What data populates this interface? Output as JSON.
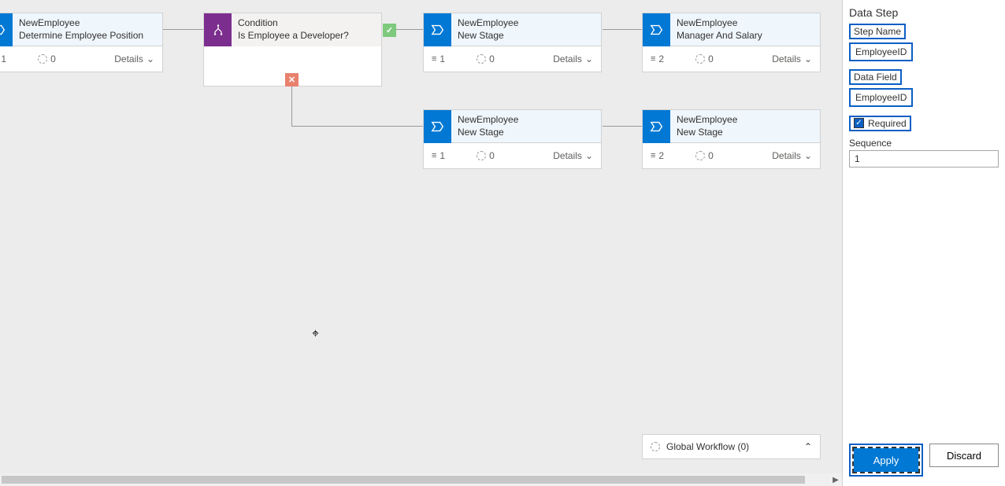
{
  "panel": {
    "title": "Data Step",
    "stepName": {
      "label": "Step Name",
      "value": "EmployeeID"
    },
    "dataField": {
      "label": "Data Field",
      "value": "EmployeeID"
    },
    "required": {
      "label": "Required",
      "checked": true
    },
    "sequence": {
      "label": "Sequence",
      "value": "1"
    },
    "apply": "Apply",
    "discard": "Discard"
  },
  "globalWorkflow": "Global Workflow (0)",
  "nodes": {
    "n1": {
      "t1": "NewEmployee",
      "t2": "Determine Employee Position",
      "cnt": "1",
      "zero": "0",
      "details": "Details"
    },
    "cond": {
      "t1": "Condition",
      "t2": "Is Employee a Developer?"
    },
    "n2": {
      "t1": "NewEmployee",
      "t2": "New Stage",
      "cnt": "1",
      "zero": "0",
      "details": "Details"
    },
    "n3": {
      "t1": "NewEmployee",
      "t2": "Manager And Salary",
      "cnt": "2",
      "zero": "0",
      "details": "Details"
    },
    "n4": {
      "t1": "NewEmployee",
      "t2": "New Stage",
      "cnt": "1",
      "zero": "0",
      "details": "Details"
    },
    "n5": {
      "t1": "NewEmployee",
      "t2": "New Stage",
      "cnt": "2",
      "zero": "0",
      "details": "Details"
    }
  }
}
